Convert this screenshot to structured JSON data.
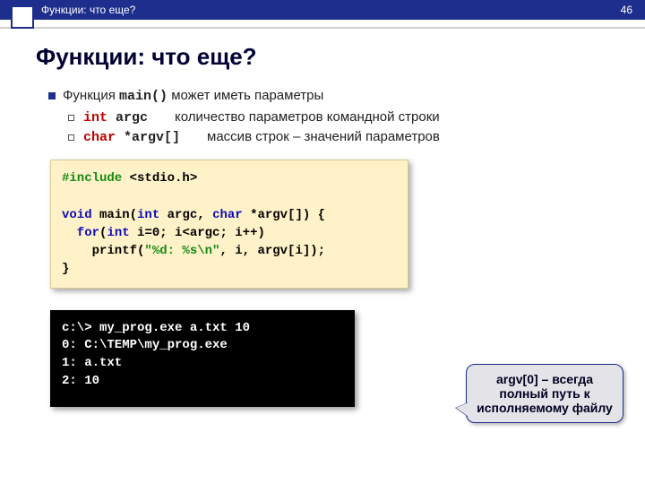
{
  "header": {
    "title": "Функции: что еще?",
    "page_number": "46"
  },
  "slide_title": "Функции: что еще?",
  "bullet_main": {
    "prefix": "Функция ",
    "code": "main()",
    "suffix": " может иметь параметры"
  },
  "sub1": {
    "type_kw": "int",
    "name": " argc",
    "desc": "количество параметров командной строки"
  },
  "sub2": {
    "type_kw": "char",
    "name": " *argv[]",
    "desc": "массив строк – значений параметров"
  },
  "code": {
    "l1a": "#include ",
    "l1b": "<stdio.h>",
    "blank": " ",
    "l2a": "void",
    "l2b": " main(",
    "l2c": "int",
    "l2d": " argc, ",
    "l2e": "char",
    "l2f": " *argv[]) {",
    "l3a": "  for",
    "l3b": "(",
    "l3c": "int",
    "l3d": " i=0; i<argc; i++)",
    "l4a": "    printf(",
    "l4b": "\"%d: %s\\n\"",
    "l4c": ", i, argv[i]);",
    "l5": "}"
  },
  "terminal": {
    "l1": "c:\\> my_prog.exe a.txt 10",
    "l2": "0: C:\\TEMP\\my_prog.exe",
    "l3": "1: a.txt",
    "l4": "2: 10"
  },
  "callout": "argv[0] – всегда полный путь к исполняемому файлу"
}
